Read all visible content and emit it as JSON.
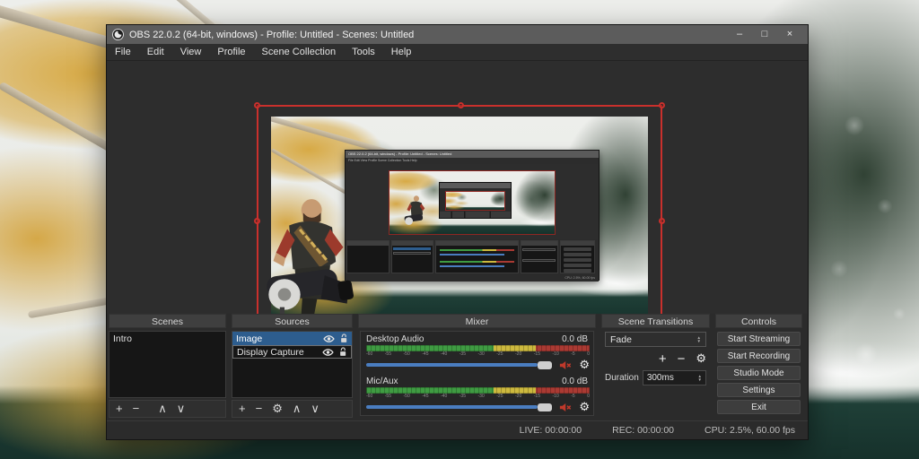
{
  "titlebar": {
    "title": "OBS 22.0.2 (64-bit, windows) - Profile: Untitled - Scenes: Untitled",
    "minimize": "–",
    "maximize": "□",
    "close": "×"
  },
  "menubar": {
    "items": [
      "File",
      "Edit",
      "View",
      "Profile",
      "Scene Collection",
      "Tools",
      "Help"
    ]
  },
  "icons": {
    "plus": "+",
    "minus": "−",
    "up": "∧",
    "down": "∨",
    "gear": "⚙",
    "spinner_up": "▲",
    "spinner_down": "▼"
  },
  "scenes": {
    "title": "Scenes",
    "items": [
      "Intro"
    ]
  },
  "sources": {
    "title": "Sources",
    "rows": [
      {
        "name": "Image"
      },
      {
        "name": "Display Capture"
      }
    ]
  },
  "mixer": {
    "title": "Mixer",
    "channels": [
      {
        "name": "Desktop Audio",
        "db": "0.0 dB"
      },
      {
        "name": "Mic/Aux",
        "db": "0.0 dB"
      }
    ],
    "ticks": [
      "-60",
      "-55",
      "-50",
      "-45",
      "-40",
      "-35",
      "-30",
      "-25",
      "-20",
      "-15",
      "-10",
      "-5",
      "0"
    ]
  },
  "transitions": {
    "title": "Scene Transitions",
    "selected": "Fade",
    "duration_label": "Duration",
    "duration_value": "300ms"
  },
  "controls": {
    "title": "Controls",
    "buttons": [
      "Start Streaming",
      "Start Recording",
      "Studio Mode",
      "Settings",
      "Exit"
    ]
  },
  "statusbar": {
    "live": "LIVE: 00:00:00",
    "rec": "REC: 00:00:00",
    "cpu": "CPU: 2.5%, 60.00 fps"
  },
  "colors": {
    "accent_red": "#c9302c",
    "selection_blue": "#2d5d8e",
    "slider_blue": "#4a7dc0",
    "meter_green": "#3f9b42",
    "meter_yellow": "#cdb93e",
    "meter_red": "#aa3a33",
    "mute_red": "#c0392b"
  }
}
